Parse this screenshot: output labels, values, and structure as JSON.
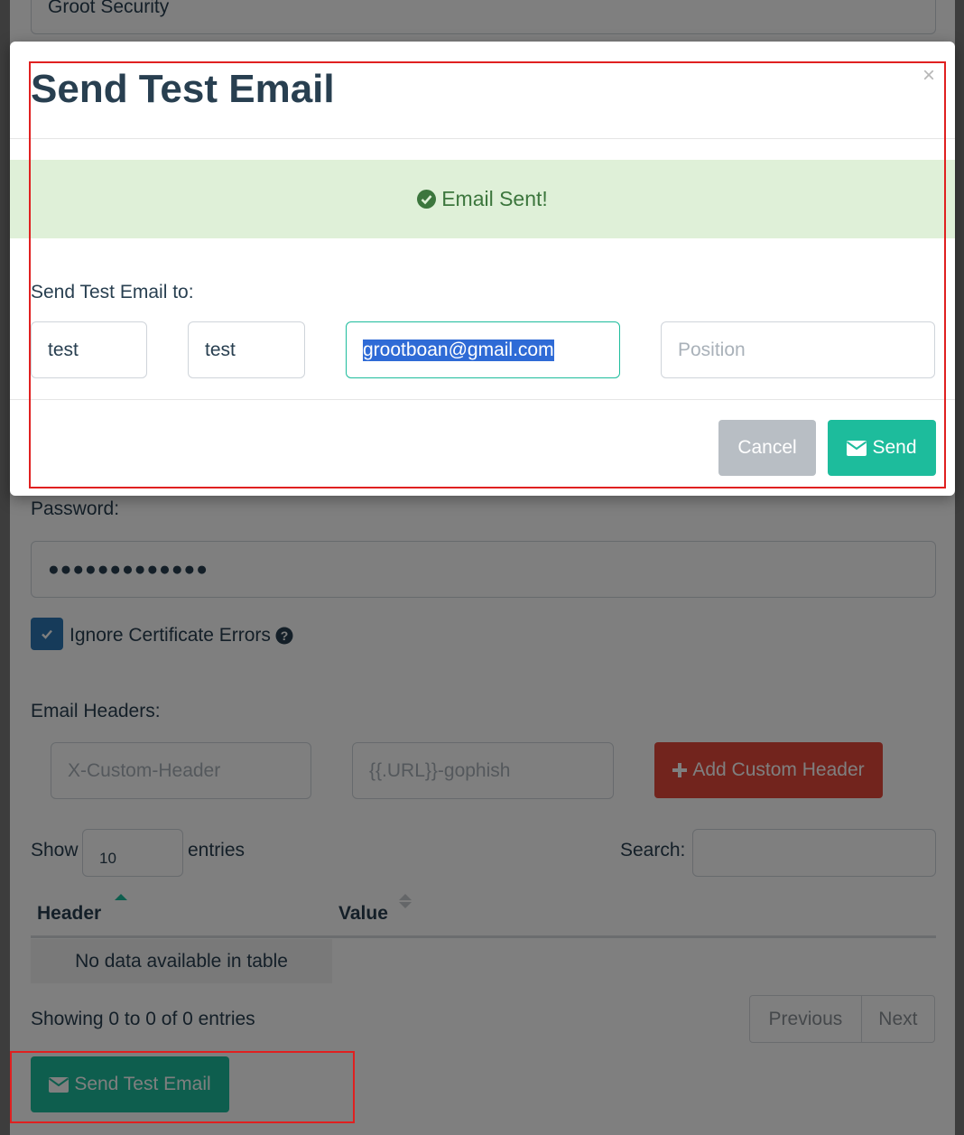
{
  "background": {
    "profile_name_value": "Groot Security",
    "password_label": "Password:",
    "password_value": "●●●●●●●●●●●●●",
    "ignore_cert_label": "Ignore Certificate Errors",
    "email_headers_label": "Email Headers:",
    "header_name_placeholder": "X-Custom-Header",
    "header_value_placeholder": "{{.URL}}-gophish",
    "add_header_button": "Add Custom Header",
    "show_label": "Show",
    "entries_count": "10",
    "entries_label": "entries",
    "search_label": "Search:",
    "table": {
      "columns": [
        "Header",
        "Value"
      ],
      "empty_message": "No data available in table"
    },
    "showing_info": "Showing 0 to 0 of 0 entries",
    "pagination": {
      "previous": "Previous",
      "next": "Next"
    },
    "send_test_email_button": "Send Test Email"
  },
  "modal": {
    "title": "Send Test Email",
    "close_symbol": "×",
    "alert_text": "Email Sent!",
    "send_to_label": "Send Test Email to:",
    "fields": {
      "first_name": "test",
      "last_name": "test",
      "email": "grootboan@gmail.com",
      "position_placeholder": "Position"
    },
    "cancel_button": "Cancel",
    "send_button": "Send"
  },
  "colors": {
    "accent_green": "#1dbc9c",
    "danger_red": "#e5493a",
    "success_text": "#3c763d",
    "success_bg": "#dff0d8",
    "annotation_red": "#e02020"
  }
}
